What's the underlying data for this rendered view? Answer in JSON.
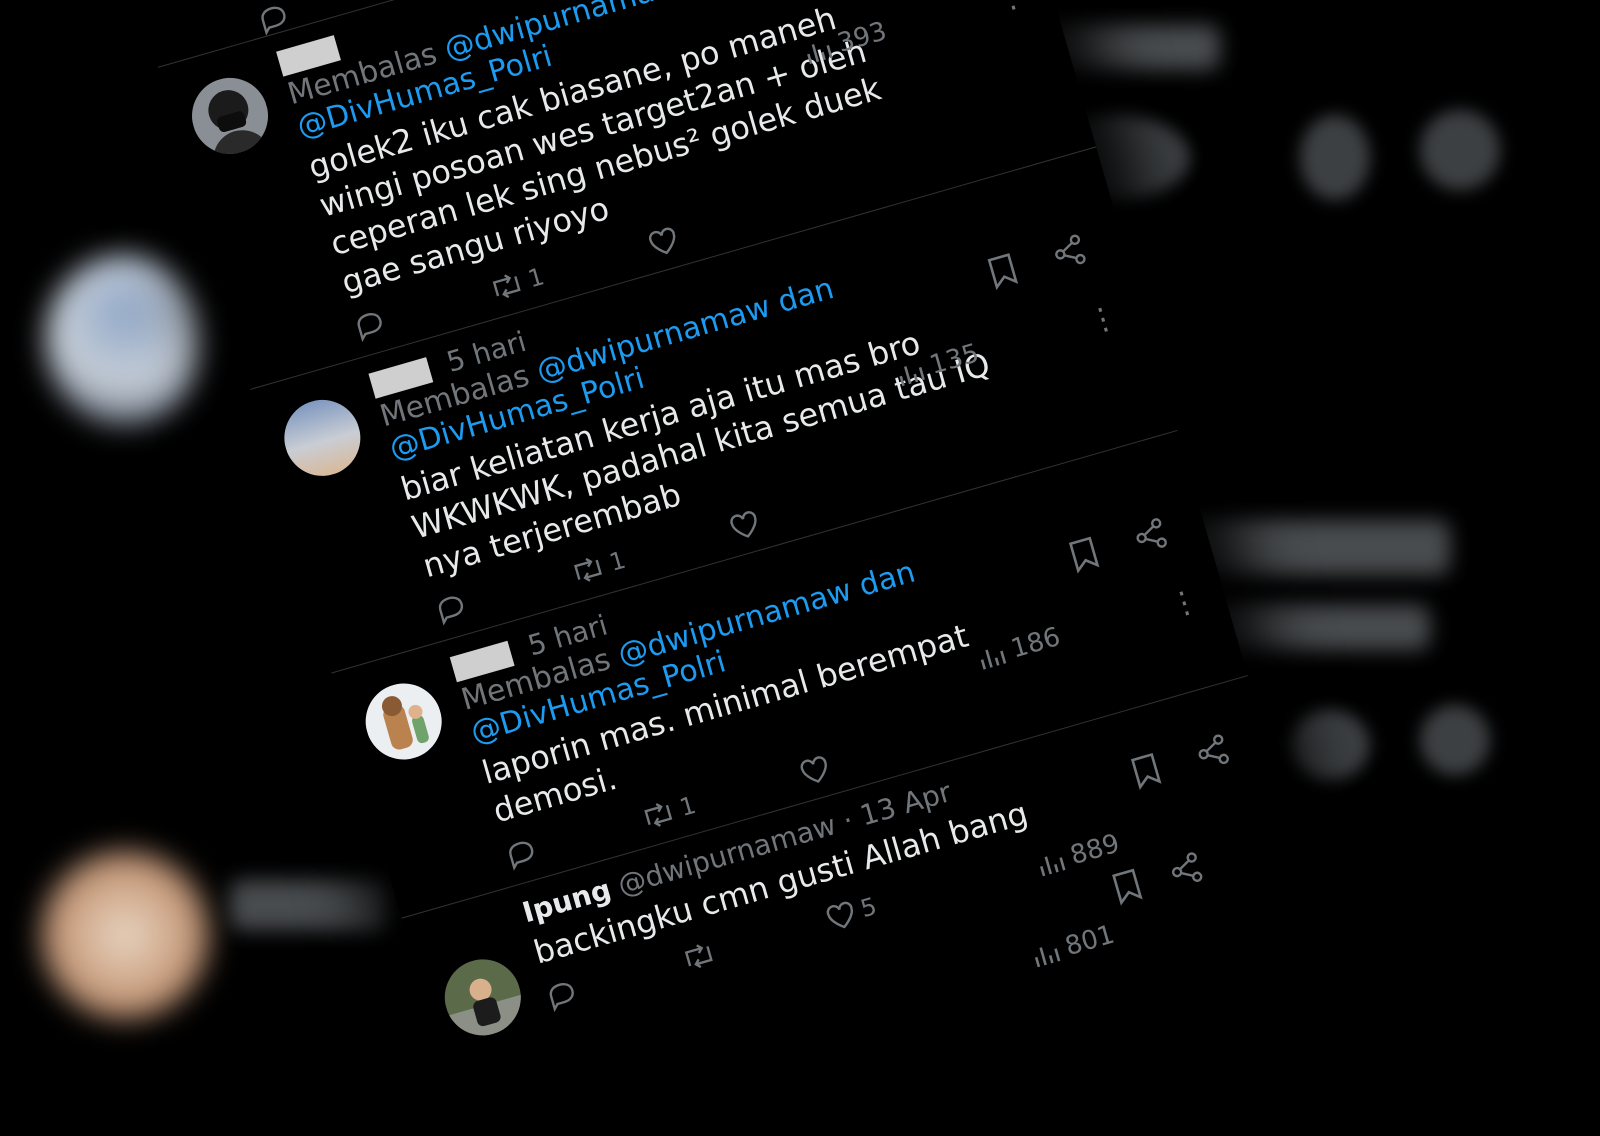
{
  "posts": [
    {
      "name": "",
      "handle": "",
      "time": "",
      "replying_prefix": "Membalas",
      "reply_mention_1": "@dwipurnamaw dan",
      "reply_mention_2": "@DivHumas_Polri",
      "text": "golek2 iku cak biasane, po maneh wingi posoan wes target2an + oleh ceperan lek sing nebus² golek duek gae sangu riyoyo",
      "views": "393",
      "reposts": "1",
      "likes": ""
    },
    {
      "name": "",
      "handle": "",
      "time": "5 hari",
      "replying_prefix": "Membalas",
      "reply_mention_1": "@dwipurnamaw dan",
      "reply_mention_2": "@DivHumas_Polri",
      "text": "biar keliatan kerja aja itu mas bro WKWKWK, padahal kita semua tau IQ nya terjerembab",
      "views": "135",
      "reposts": "1",
      "likes": ""
    },
    {
      "name": "",
      "handle": "",
      "time": "5 hari",
      "replying_prefix": "Membalas",
      "reply_mention_1": "@dwipurnamaw dan",
      "reply_mention_2": "@DivHumas_Polri",
      "text": "laporin mas. minimal berempat demosi.",
      "views": "186",
      "reposts": "1",
      "likes": ""
    },
    {
      "name": "Ipung",
      "handle": "@dwipurnamaw",
      "time": "· 13 Apr",
      "replying_prefix": "",
      "reply_mention_1": "",
      "reply_mention_2": "",
      "text": "backingku cmn gusti Allah bang",
      "views": "889",
      "reposts": "",
      "likes": "5"
    }
  ],
  "footer_views": "801",
  "colors": {
    "mention": "#1d9bf0",
    "muted": "#71767b",
    "text": "#e7e9ea"
  }
}
